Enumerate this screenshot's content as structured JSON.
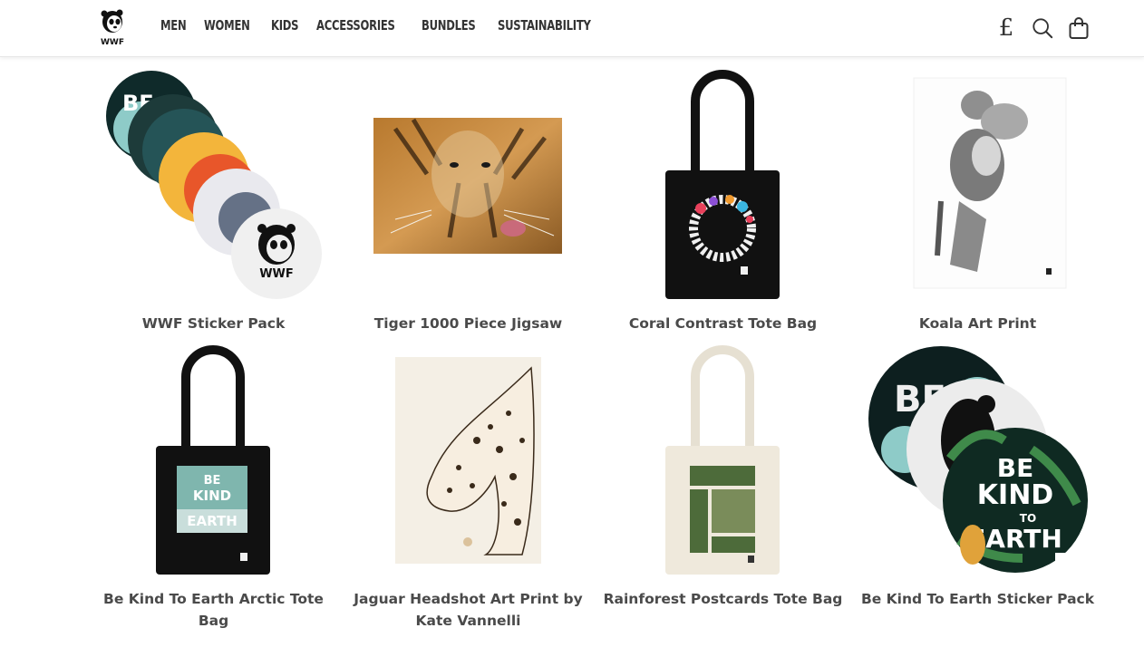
{
  "brand": {
    "logo_text": "WWF"
  },
  "nav": {
    "items": [
      "MEN",
      "WOMEN",
      "KIDS",
      "ACCESSORIES",
      "BUNDLES",
      "SUSTAINABILITY"
    ]
  },
  "header_icons": {
    "currency_symbol": "£",
    "search": "search-icon",
    "cart": "shopping-bag-icon"
  },
  "products": [
    {
      "title": "WWF Sticker Pack"
    },
    {
      "title": "Tiger 1000 Piece Jigsaw"
    },
    {
      "title": "Coral Contrast Tote Bag"
    },
    {
      "title": "Koala Art Print"
    },
    {
      "title": "Be Kind To Earth Arctic Tote Bag"
    },
    {
      "title": "Jaguar Headshot Art Print by Kate Vannelli"
    },
    {
      "title": "Rainforest Postcards Tote Bag"
    },
    {
      "title": "Be Kind To Earth Sticker Pack"
    }
  ],
  "artwork_text": {
    "be": "BE",
    "kind": "KIND",
    "to": "TO",
    "earth": "EARTH",
    "wwf": "WWF"
  },
  "colors": {
    "text": "#333333",
    "title": "#4a4a4a",
    "border": "#e6e6e6"
  }
}
